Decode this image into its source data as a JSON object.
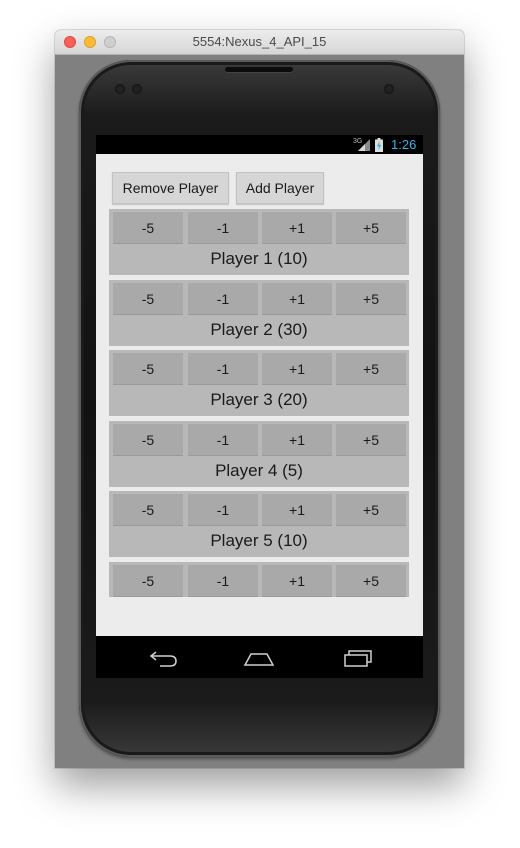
{
  "window": {
    "title": "5554:Nexus_4_API_15"
  },
  "status": {
    "network": "3G",
    "time": "1:26"
  },
  "toolbar": {
    "remove_label": "Remove Player",
    "add_label": "Add Player"
  },
  "steps": [
    "-5",
    "-1",
    "+1",
    "+5"
  ],
  "players": [
    {
      "label": "Player 1 (10)"
    },
    {
      "label": "Player 2 (30)"
    },
    {
      "label": "Player 3 (20)"
    },
    {
      "label": "Player 4 (5)"
    },
    {
      "label": "Player 5 (10)"
    },
    {
      "label": ""
    }
  ],
  "icons": {
    "back": "back-arrow-icon",
    "home": "home-icon",
    "recents": "recent-apps-icon"
  },
  "colors": {
    "clock": "#33b5e5",
    "app_bg": "#ececec",
    "player_bg": "#b8b8b8",
    "step_button": "#a9a9a9"
  }
}
